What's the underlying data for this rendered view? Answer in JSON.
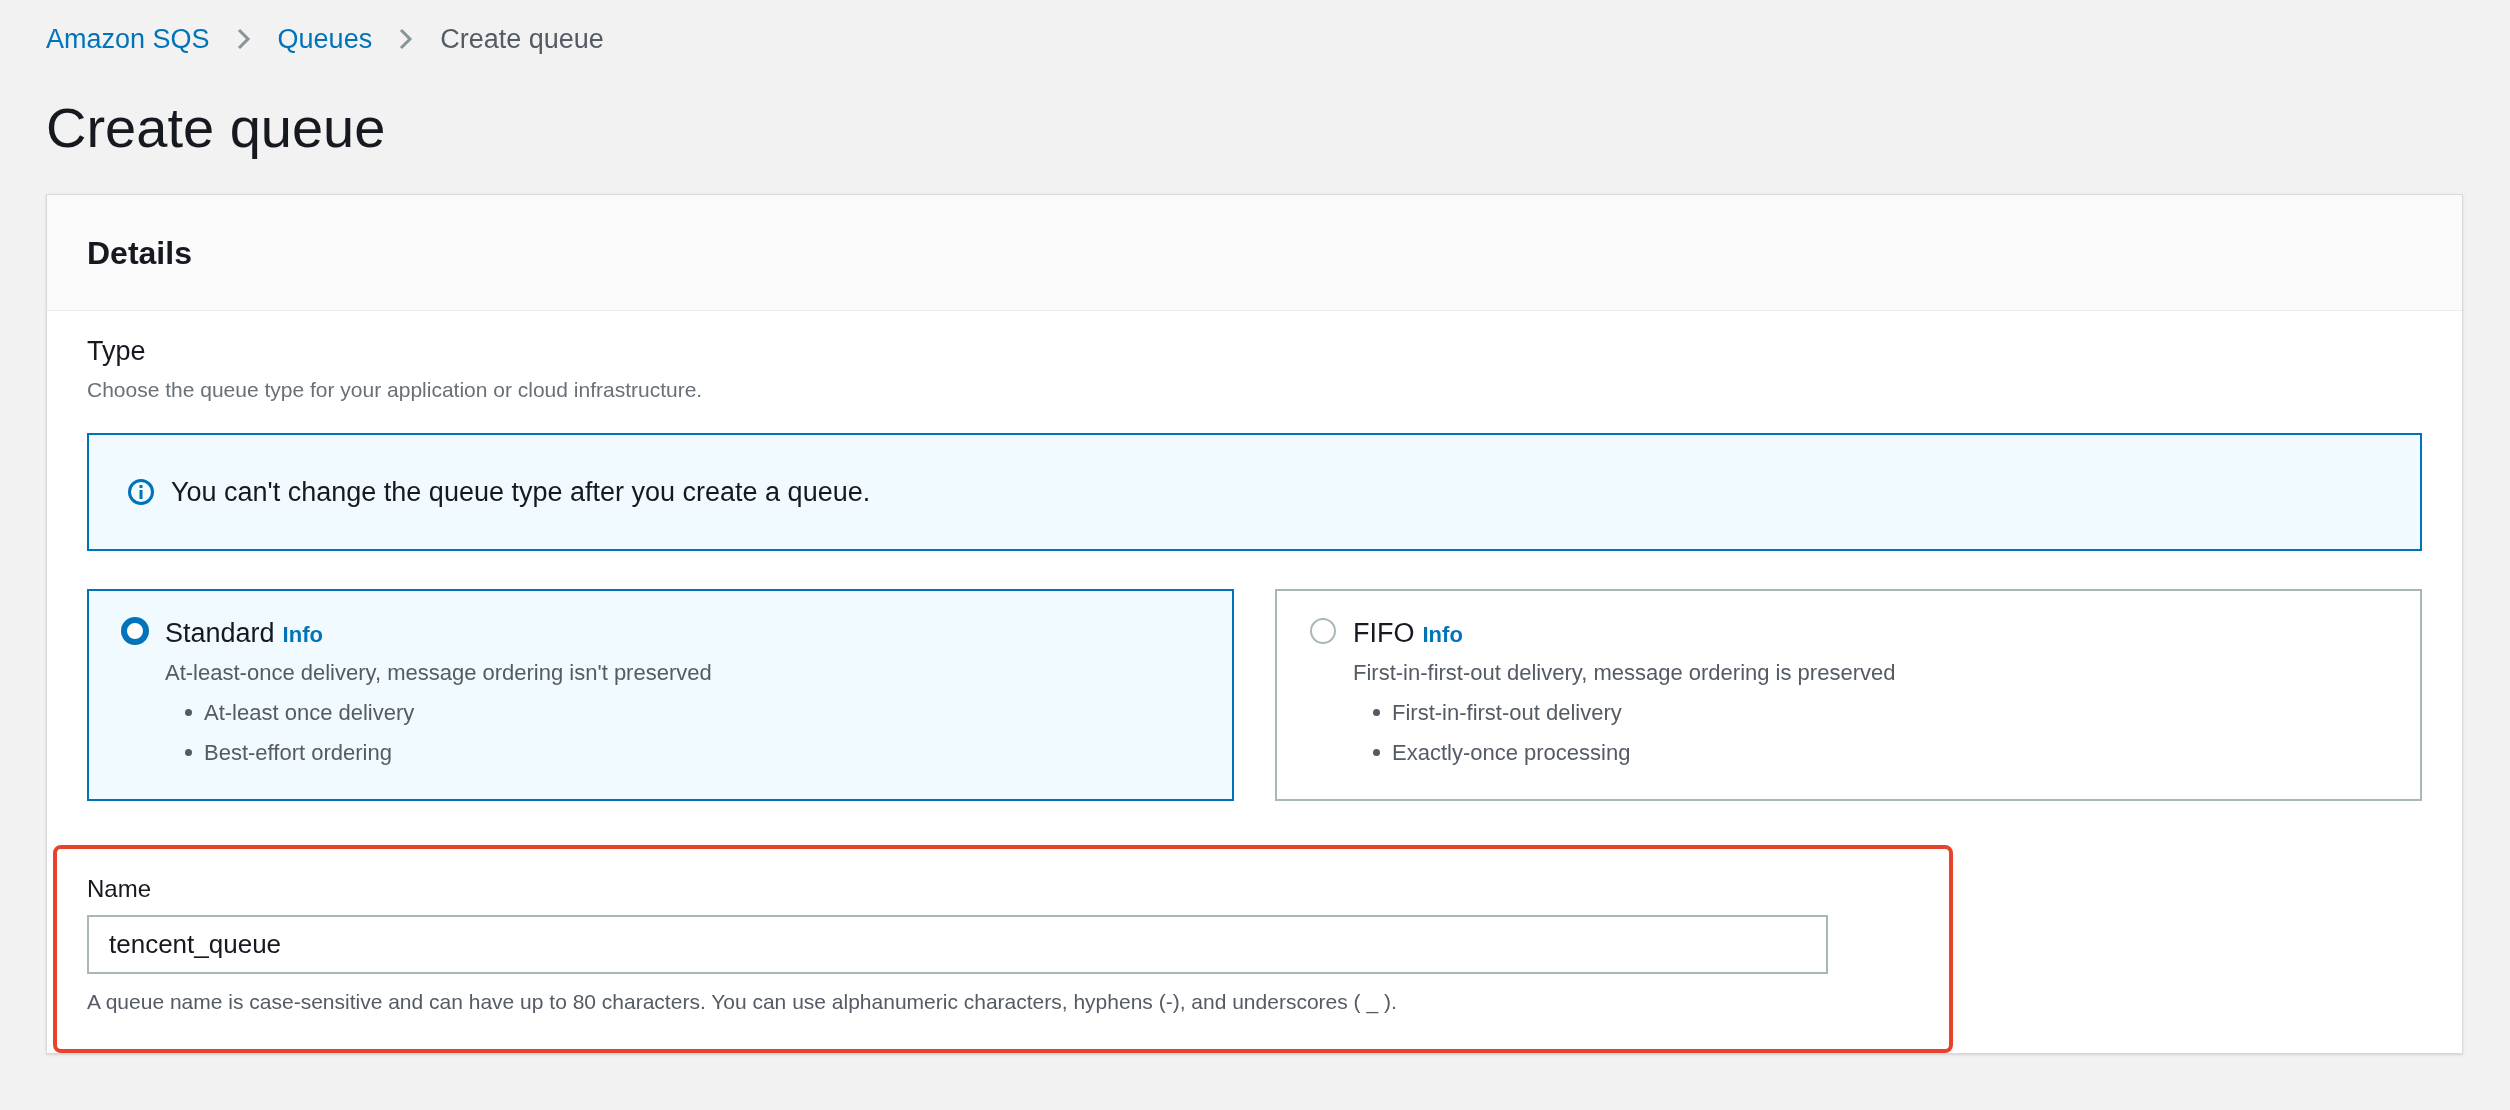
{
  "breadcrumb": [
    {
      "label": "Amazon SQS",
      "kind": "link"
    },
    {
      "label": "Queues",
      "kind": "link"
    },
    {
      "label": "Create queue",
      "kind": "current"
    }
  ],
  "title": "Create queue",
  "details": {
    "heading": "Details",
    "type": {
      "label": "Type",
      "description": "Choose the queue type for your application or cloud infrastructure.",
      "alert": "You can't change the queue type after you create a queue.",
      "options": [
        {
          "title": "Standard",
          "info": "Info",
          "description": "At-least-once delivery, message ordering isn't preserved",
          "bullets": [
            "At-least once delivery",
            "Best-effort ordering"
          ],
          "selected": true
        },
        {
          "title": "FIFO",
          "info": "Info",
          "description": "First-in-first-out delivery, message ordering is preserved",
          "bullets": [
            "First-in-first-out delivery",
            "Exactly-once processing"
          ],
          "selected": false
        }
      ]
    },
    "name": {
      "label": "Name",
      "value": "tencent_queue",
      "hint": "A queue name is case-sensitive and can have up to 80 characters. You can use alphanumeric characters, hyphens (-), and underscores ( _ )."
    }
  }
}
